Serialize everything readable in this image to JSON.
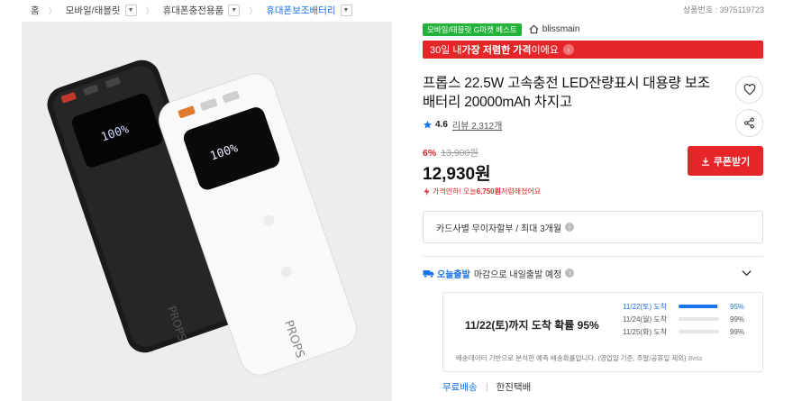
{
  "breadcrumb": {
    "items": [
      "홈",
      "모바일/태블릿",
      "휴대폰충전용품",
      "휴대폰보조배터리"
    ],
    "separator": "〉"
  },
  "product_number": "상품번호 : 3975119723",
  "badges": {
    "best": "모바일/태블릿 G마켓 베스트",
    "seller": "blissmain"
  },
  "promo": {
    "prefix": "30일 내 ",
    "highlight": "가장 저렴한 가격",
    "suffix": "이에요"
  },
  "product": {
    "title": "프롭스 22.5W 고속충전 LED잔량표시 대용량 보조배터리 20000mAh 차지고",
    "rating": "4.6",
    "review_count": "리뷰 2,312개"
  },
  "price": {
    "discount": "6%",
    "original": "13,900원",
    "current": "12,930원",
    "drop_prefix": "가격인하! 오늘 ",
    "drop_amount": "6,750원",
    "drop_suffix": " 저렴해졌어요"
  },
  "coupon_label": "쿠폰받기",
  "card_installment": "카드사별 무이자할부 / 최대 3개월",
  "delivery": {
    "today_label": "오늘출발",
    "description": "마감으로 내일출발 예정",
    "probability_text": "11/22(토)까지 도착 확률 95%",
    "rows": [
      {
        "label": "11/22(토) 도착",
        "percent": "95%",
        "fill": 0.95,
        "highlight": true
      },
      {
        "label": "11/24(월) 도착",
        "percent": "99%",
        "fill": 0.0,
        "highlight": false
      },
      {
        "label": "11/25(화) 도착",
        "percent": "99%",
        "fill": 0.0,
        "highlight": false
      }
    ],
    "note": "배송데이터 기반으로 분석한 예측 배송확률입니다. (영업일 기준, 주말/공휴일 제외)",
    "beta": "Beta"
  },
  "shipping": {
    "fee": "무료배송",
    "carrier": "한진택배"
  },
  "power_bank": {
    "display_text": "100%",
    "brand_text": "PROPS"
  },
  "colors": {
    "accent_red": "#e52528",
    "accent_blue": "#1a73e8",
    "badge_green": "#24b23a"
  }
}
